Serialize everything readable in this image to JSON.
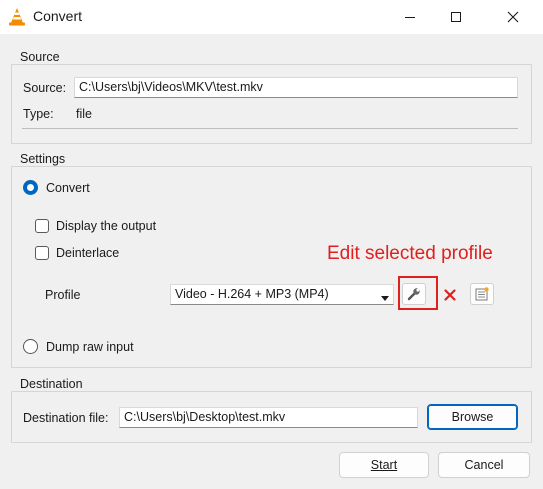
{
  "window": {
    "title": "Convert"
  },
  "source": {
    "group_title": "Source",
    "source_label": "Source:",
    "source_value": "C:\\Users\\bj\\Videos\\MKV\\test.mkv",
    "type_label": "Type:",
    "type_value": "file"
  },
  "settings": {
    "group_title": "Settings",
    "convert_label": "Convert",
    "display_output_label": "Display the output",
    "deinterlace_label": "Deinterlace",
    "profile_label": "Profile",
    "profile_value": "Video - H.264 + MP3 (MP4)",
    "dump_raw_label": "Dump raw input"
  },
  "annotation": {
    "text": "Edit selected profile",
    "color": "#e0201e"
  },
  "destination": {
    "group_title": "Destination",
    "file_label": "Destination file:",
    "file_value": "C:\\Users\\bj\\Desktop\\test.mkv",
    "browse_label": "Browse"
  },
  "footer": {
    "start_label": "Start",
    "cancel_label": "Cancel"
  },
  "colors": {
    "accent": "#0067c0",
    "delete_red": "#e02020"
  }
}
